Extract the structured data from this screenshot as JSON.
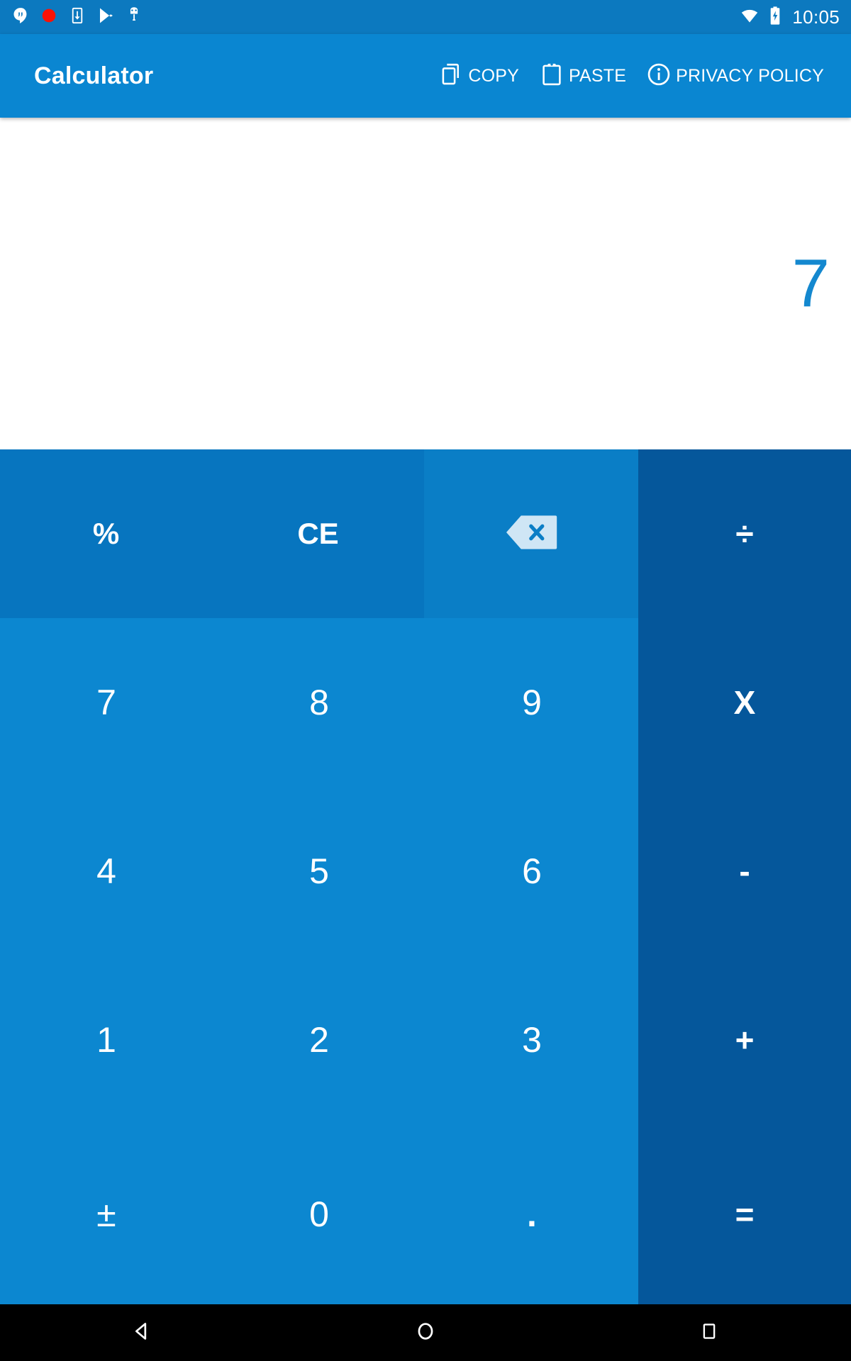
{
  "status_bar": {
    "background": "#0c79bf",
    "time": "10:05",
    "left_icons": [
      {
        "name": "hangouts-icon"
      },
      {
        "name": "record-dot-icon",
        "color": "#fa1205"
      },
      {
        "name": "download-to-device-icon"
      },
      {
        "name": "play-store-icon"
      },
      {
        "name": "android-robot-icon"
      }
    ],
    "right_icons": [
      {
        "name": "wifi-icon"
      },
      {
        "name": "battery-charging-icon"
      }
    ]
  },
  "app_bar": {
    "background": "#0a86d1",
    "title": "Calculator",
    "actions": [
      {
        "name": "copy-button",
        "label": "COPY",
        "icon": "content-copy-icon"
      },
      {
        "name": "paste-button",
        "label": "PASTE",
        "icon": "clipboard-icon"
      },
      {
        "name": "privacy-policy-button",
        "label": "PRIVACY POLICY",
        "icon": "info-circle-icon"
      }
    ]
  },
  "display": {
    "background": "#ffffff",
    "value": "7",
    "value_color": "#1488cf"
  },
  "keypad": {
    "colors": {
      "function": "#0775bf",
      "backspace": "#0a7ec6",
      "number": "#0c87d0",
      "operator": "#05579b"
    },
    "rows": [
      [
        {
          "name": "percent-key",
          "label": "%",
          "kind": "fn"
        },
        {
          "name": "clear-entry-key",
          "label": "CE",
          "kind": "fn"
        },
        {
          "name": "backspace-key",
          "label": "",
          "kind": "back",
          "icon": "backspace-icon"
        },
        {
          "name": "divide-key",
          "label": "÷",
          "kind": "op"
        }
      ],
      [
        {
          "name": "digit-7-key",
          "label": "7",
          "kind": "num"
        },
        {
          "name": "digit-8-key",
          "label": "8",
          "kind": "num"
        },
        {
          "name": "digit-9-key",
          "label": "9",
          "kind": "num"
        },
        {
          "name": "multiply-key",
          "label": "X",
          "kind": "op"
        }
      ],
      [
        {
          "name": "digit-4-key",
          "label": "4",
          "kind": "num"
        },
        {
          "name": "digit-5-key",
          "label": "5",
          "kind": "num"
        },
        {
          "name": "digit-6-key",
          "label": "6",
          "kind": "num"
        },
        {
          "name": "minus-key",
          "label": "-",
          "kind": "op"
        }
      ],
      [
        {
          "name": "digit-1-key",
          "label": "1",
          "kind": "num"
        },
        {
          "name": "digit-2-key",
          "label": "2",
          "kind": "num"
        },
        {
          "name": "digit-3-key",
          "label": "3",
          "kind": "num"
        },
        {
          "name": "plus-key",
          "label": "+",
          "kind": "op"
        }
      ],
      [
        {
          "name": "plus-minus-key",
          "label": "±",
          "kind": "num"
        },
        {
          "name": "digit-0-key",
          "label": "0",
          "kind": "num"
        },
        {
          "name": "decimal-point-key",
          "label": ".",
          "kind": "num"
        },
        {
          "name": "equals-key",
          "label": "=",
          "kind": "op"
        }
      ]
    ]
  },
  "nav_bar": {
    "background": "#000000",
    "buttons": [
      {
        "name": "nav-back-button",
        "icon": "triangle-back-icon"
      },
      {
        "name": "nav-home-button",
        "icon": "circle-home-icon"
      },
      {
        "name": "nav-recents-button",
        "icon": "square-recents-icon"
      }
    ]
  }
}
